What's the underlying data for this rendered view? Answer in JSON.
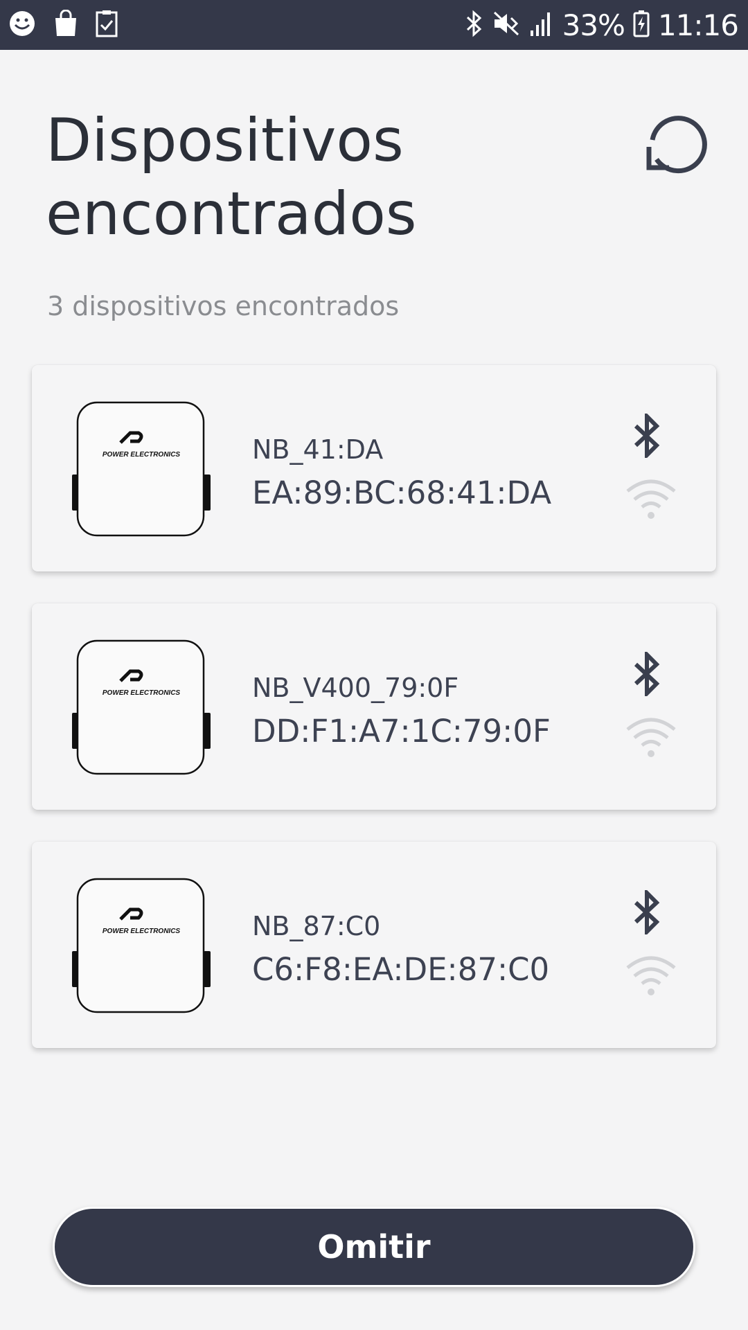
{
  "status_bar": {
    "battery": "33%",
    "time": "11:16",
    "left_icons": [
      "smiley-icon",
      "shopping-bag-icon",
      "clipboard-check-icon"
    ],
    "right_icons": [
      "bluetooth-icon",
      "mute-vibrate-icon",
      "signal-icon",
      "battery-charging-icon"
    ]
  },
  "header": {
    "title": "Dispositivos encontrados",
    "refresh_icon": "refresh-icon"
  },
  "summary": "3 dispositivos encontrados",
  "devices": [
    {
      "name": "NB_41:DA",
      "mac": "EA:89:BC:68:41:DA",
      "brand": "POWER ELECTRONICS"
    },
    {
      "name": "NB_V400_79:0F",
      "mac": "DD:F1:A7:1C:79:0F",
      "brand": "POWER ELECTRONICS"
    },
    {
      "name": "NB_87:C0",
      "mac": "C6:F8:EA:DE:87:C0",
      "brand": "POWER ELECTRONICS"
    }
  ],
  "footer": {
    "omit_label": "Omitir"
  },
  "colors": {
    "primary_dark": "#343849",
    "background": "#f4f4f5",
    "text_muted": "#8a8c90",
    "wifi_inactive": "#d2d3d6"
  }
}
